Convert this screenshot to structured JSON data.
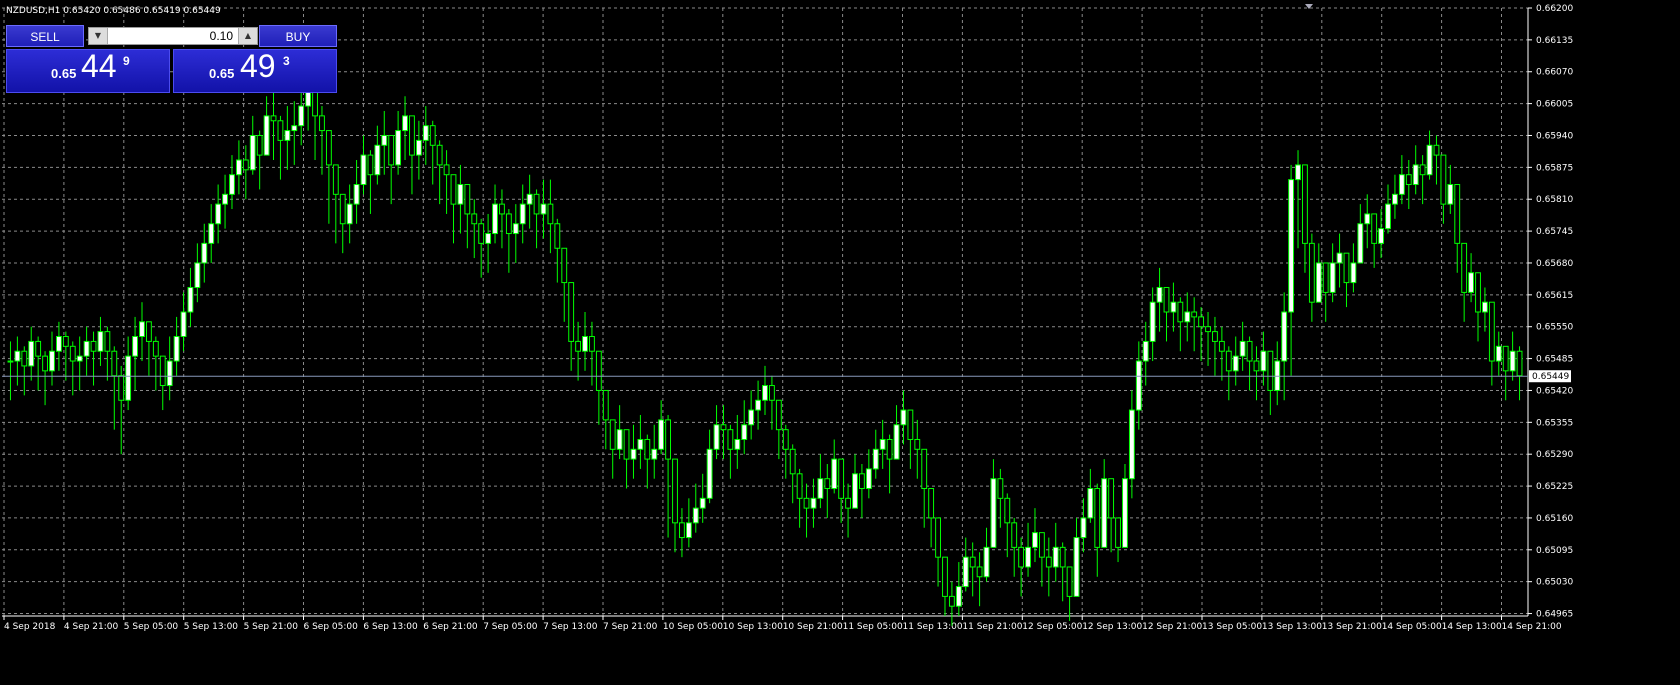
{
  "header": {
    "ohlc_text": "NZDUSD,H1  0.65420 0.65486 0.65419 0.65449"
  },
  "trade_panel": {
    "sell_label": "SELL",
    "buy_label": "BUY",
    "lot": "0.10",
    "bid": {
      "prefix": "0.65",
      "big": "44",
      "sup": "9"
    },
    "ask": {
      "prefix": "0.65",
      "big": "49",
      "sup": "3"
    }
  },
  "colors": {
    "background": "#000000",
    "grid": "#8a8a8a",
    "candle": "#00ff00",
    "candle_body": "#ffffff",
    "axis_text": "#ffffff",
    "price_line": "#8899bb"
  },
  "chart_data": {
    "type": "candlestick",
    "symbol": "NZDUSD",
    "timeframe": "H1",
    "ylim": [
      0.6496,
      0.662
    ],
    "y_ticks": [
      "0.66200",
      "0.66135",
      "0.66070",
      "0.66005",
      "0.65940",
      "0.65875",
      "0.65810",
      "0.65745",
      "0.65680",
      "0.65615",
      "0.65550",
      "0.65485",
      "0.65420",
      "0.65355",
      "0.65290",
      "0.65225",
      "0.65160",
      "0.65095",
      "0.65030",
      "0.64965"
    ],
    "x_ticks": [
      "4 Sep 2018",
      "4 Sep 21:00",
      "5 Sep 05:00",
      "5 Sep 13:00",
      "5 Sep 21:00",
      "6 Sep 05:00",
      "6 Sep 13:00",
      "6 Sep 21:00",
      "7 Sep 05:00",
      "7 Sep 13:00",
      "7 Sep 21:00",
      "10 Sep 05:00",
      "10 Sep 13:00",
      "10 Sep 21:00",
      "11 Sep 05:00",
      "11 Sep 13:00",
      "11 Sep 21:00",
      "12 Sep 05:00",
      "12 Sep 13:00",
      "12 Sep 21:00",
      "13 Sep 05:00",
      "13 Sep 13:00",
      "13 Sep 21:00",
      "14 Sep 05:00",
      "14 Sep 13:00",
      "14 Sep 21:00"
    ],
    "current_price": "0.65449",
    "grid": true,
    "close": [
      0.6548,
      0.655,
      0.6547,
      0.6552,
      0.6549,
      0.6546,
      0.655,
      0.6553,
      0.6551,
      0.6548,
      0.6549,
      0.6552,
      0.655,
      0.6554,
      0.655,
      0.6545,
      0.654,
      0.6549,
      0.6553,
      0.6556,
      0.6552,
      0.6549,
      0.6543,
      0.6548,
      0.6553,
      0.6558,
      0.6563,
      0.6568,
      0.6572,
      0.6576,
      0.658,
      0.6582,
      0.6586,
      0.6589,
      0.6587,
      0.6594,
      0.659,
      0.6598,
      0.6597,
      0.6593,
      0.6595,
      0.6596,
      0.66,
      0.6604,
      0.6598,
      0.6595,
      0.6588,
      0.6582,
      0.6576,
      0.658,
      0.6584,
      0.659,
      0.6586,
      0.6592,
      0.6594,
      0.6588,
      0.6595,
      0.6598,
      0.659,
      0.6593,
      0.6596,
      0.6592,
      0.6588,
      0.6586,
      0.658,
      0.6584,
      0.6578,
      0.6576,
      0.6572,
      0.6574,
      0.658,
      0.6578,
      0.6574,
      0.6576,
      0.658,
      0.6582,
      0.6578,
      0.658,
      0.6576,
      0.6571,
      0.6564,
      0.6552,
      0.655,
      0.6553,
      0.655,
      0.6542,
      0.6536,
      0.653,
      0.6534,
      0.6528,
      0.653,
      0.6532,
      0.6528,
      0.653,
      0.6536,
      0.6528,
      0.6515,
      0.6512,
      0.6515,
      0.6518,
      0.652,
      0.653,
      0.6535,
      0.6534,
      0.653,
      0.6532,
      0.6535,
      0.6538,
      0.654,
      0.6543,
      0.654,
      0.6534,
      0.653,
      0.6525,
      0.652,
      0.6518,
      0.652,
      0.6524,
      0.6522,
      0.6528,
      0.652,
      0.6518,
      0.6525,
      0.6522,
      0.6526,
      0.653,
      0.6532,
      0.6528,
      0.6535,
      0.6538,
      0.6532,
      0.653,
      0.6522,
      0.6516,
      0.6508,
      0.65,
      0.6498,
      0.6502,
      0.6508,
      0.6506,
      0.6504,
      0.651,
      0.6524,
      0.652,
      0.6515,
      0.651,
      0.6506,
      0.651,
      0.6513,
      0.6508,
      0.6506,
      0.651,
      0.6506,
      0.65,
      0.6512,
      0.6516,
      0.6522,
      0.651,
      0.6524,
      0.6516,
      0.651,
      0.6524,
      0.6538,
      0.6548,
      0.6552,
      0.656,
      0.6563,
      0.6558,
      0.656,
      0.6556,
      0.6558,
      0.6557,
      0.6555,
      0.6554,
      0.6552,
      0.655,
      0.6546,
      0.6549,
      0.6552,
      0.6548,
      0.6546,
      0.655,
      0.6542,
      0.6548,
      0.6558,
      0.6585,
      0.6588,
      0.6572,
      0.656,
      0.6568,
      0.6562,
      0.6568,
      0.657,
      0.6564,
      0.6568,
      0.6576,
      0.6578,
      0.6572,
      0.6575,
      0.658,
      0.6582,
      0.6586,
      0.6584,
      0.6588,
      0.6586,
      0.6592,
      0.659,
      0.658,
      0.6584,
      0.6572,
      0.6562,
      0.6566,
      0.6558,
      0.656,
      0.6548,
      0.6551,
      0.6546,
      0.655,
      0.6545
    ],
    "high": [
      0.6552,
      0.6553,
      0.6551,
      0.6555,
      0.6553,
      0.655,
      0.6554,
      0.6556,
      0.6554,
      0.6552,
      0.6553,
      0.6555,
      0.6554,
      0.6557,
      0.6555,
      0.6551,
      0.6547,
      0.6553,
      0.6557,
      0.656,
      0.6556,
      0.6553,
      0.6549,
      0.6553,
      0.6557,
      0.6562,
      0.6567,
      0.6572,
      0.6576,
      0.658,
      0.6584,
      0.6586,
      0.659,
      0.6593,
      0.6592,
      0.6598,
      0.6595,
      0.6602,
      0.6603,
      0.6598,
      0.66,
      0.6601,
      0.6604,
      0.6606,
      0.6604,
      0.66,
      0.6593,
      0.6587,
      0.6582,
      0.6584,
      0.6589,
      0.6594,
      0.6591,
      0.6596,
      0.6599,
      0.6593,
      0.6599,
      0.6602,
      0.6596,
      0.6597,
      0.66,
      0.6597,
      0.6593,
      0.6591,
      0.6586,
      0.6588,
      0.6583,
      0.6581,
      0.6577,
      0.6578,
      0.6584,
      0.6583,
      0.6579,
      0.658,
      0.6584,
      0.6586,
      0.6583,
      0.6585,
      0.6585,
      0.6577,
      0.657,
      0.656,
      0.6556,
      0.6558,
      0.6556,
      0.6548,
      0.6542,
      0.6536,
      0.6539,
      0.6534,
      0.6535,
      0.6537,
      0.6533,
      0.6535,
      0.654,
      0.6537,
      0.6528,
      0.6518,
      0.652,
      0.6523,
      0.6525,
      0.6534,
      0.6539,
      0.6539,
      0.6535,
      0.6537,
      0.654,
      0.6542,
      0.6544,
      0.6547,
      0.6545,
      0.654,
      0.6535,
      0.6531,
      0.6526,
      0.6523,
      0.6524,
      0.6529,
      0.6527,
      0.6532,
      0.6528,
      0.6523,
      0.6529,
      0.6527,
      0.653,
      0.6534,
      0.6536,
      0.6533,
      0.6539,
      0.6542,
      0.6538,
      0.6536,
      0.6528,
      0.6522,
      0.6514,
      0.6507,
      0.6503,
      0.6507,
      0.6512,
      0.6511,
      0.6509,
      0.6514,
      0.6528,
      0.6526,
      0.6521,
      0.6516,
      0.6512,
      0.6515,
      0.6518,
      0.6513,
      0.6512,
      0.6515,
      0.6511,
      0.6506,
      0.6516,
      0.652,
      0.6526,
      0.6523,
      0.6528,
      0.6524,
      0.6515,
      0.6527,
      0.6542,
      0.6552,
      0.6556,
      0.6563,
      0.6567,
      0.6563,
      0.6564,
      0.6561,
      0.6562,
      0.6561,
      0.6559,
      0.6558,
      0.6557,
      0.6555,
      0.6551,
      0.6553,
      0.6556,
      0.6553,
      0.6551,
      0.6554,
      0.655,
      0.6552,
      0.6562,
      0.6588,
      0.6591,
      0.6587,
      0.6574,
      0.6572,
      0.6567,
      0.6572,
      0.6574,
      0.657,
      0.6572,
      0.658,
      0.6582,
      0.6578,
      0.6579,
      0.6584,
      0.6586,
      0.659,
      0.6589,
      0.6592,
      0.659,
      0.6595,
      0.6594,
      0.6589,
      0.6588,
      0.6584,
      0.657,
      0.657,
      0.6564,
      0.6563,
      0.6558,
      0.6554,
      0.6551,
      0.6554,
      0.6551
    ],
    "low": [
      0.654,
      0.6543,
      0.6541,
      0.6544,
      0.6542,
      0.6539,
      0.6543,
      0.6546,
      0.6544,
      0.6541,
      0.6542,
      0.6545,
      0.6543,
      0.6547,
      0.6544,
      0.6534,
      0.6529,
      0.6538,
      0.6542,
      0.6548,
      0.6545,
      0.6542,
      0.6538,
      0.654,
      0.6545,
      0.655,
      0.6555,
      0.656,
      0.6564,
      0.6568,
      0.6572,
      0.6575,
      0.6579,
      0.6582,
      0.6581,
      0.6586,
      0.6583,
      0.659,
      0.6589,
      0.6585,
      0.6587,
      0.6588,
      0.6592,
      0.6595,
      0.6589,
      0.6586,
      0.6576,
      0.6572,
      0.657,
      0.6572,
      0.6576,
      0.6582,
      0.6578,
      0.6584,
      0.6586,
      0.658,
      0.6586,
      0.6589,
      0.6582,
      0.6585,
      0.6588,
      0.6584,
      0.658,
      0.6578,
      0.6572,
      0.6574,
      0.6571,
      0.6569,
      0.6565,
      0.6566,
      0.6572,
      0.6571,
      0.6566,
      0.6568,
      0.6572,
      0.6575,
      0.6571,
      0.6573,
      0.657,
      0.6564,
      0.6556,
      0.6546,
      0.6544,
      0.6546,
      0.6543,
      0.6535,
      0.653,
      0.6524,
      0.6528,
      0.6522,
      0.6524,
      0.6526,
      0.6522,
      0.6524,
      0.6529,
      0.6512,
      0.6509,
      0.6508,
      0.651,
      0.6513,
      0.6515,
      0.6519,
      0.6528,
      0.6528,
      0.6524,
      0.6526,
      0.6529,
      0.6532,
      0.6534,
      0.6537,
      0.6534,
      0.6528,
      0.6524,
      0.6519,
      0.6514,
      0.6512,
      0.6514,
      0.6518,
      0.6516,
      0.6521,
      0.6515,
      0.6512,
      0.6519,
      0.6516,
      0.652,
      0.6524,
      0.6526,
      0.6521,
      0.6528,
      0.6531,
      0.6526,
      0.6524,
      0.6514,
      0.651,
      0.6502,
      0.6496,
      0.6494,
      0.6496,
      0.6501,
      0.65,
      0.6498,
      0.6503,
      0.6515,
      0.6514,
      0.6508,
      0.6504,
      0.65,
      0.6504,
      0.6507,
      0.6502,
      0.65,
      0.6503,
      0.6499,
      0.6495,
      0.65,
      0.6509,
      0.6515,
      0.6504,
      0.6512,
      0.6509,
      0.6507,
      0.6512,
      0.652,
      0.6534,
      0.6543,
      0.6548,
      0.6554,
      0.6552,
      0.6554,
      0.655,
      0.6552,
      0.655,
      0.6548,
      0.6547,
      0.6545,
      0.6544,
      0.654,
      0.6543,
      0.6546,
      0.6542,
      0.654,
      0.6543,
      0.6537,
      0.6539,
      0.654,
      0.6545,
      0.6571,
      0.6566,
      0.6556,
      0.656,
      0.6556,
      0.656,
      0.6563,
      0.6559,
      0.6562,
      0.6568,
      0.6571,
      0.6567,
      0.6569,
      0.6574,
      0.6577,
      0.658,
      0.6579,
      0.6582,
      0.658,
      0.6585,
      0.6584,
      0.6576,
      0.6578,
      0.6566,
      0.6556,
      0.656,
      0.6552,
      0.6554,
      0.6543,
      0.6545,
      0.654,
      0.6544,
      0.654
    ]
  }
}
